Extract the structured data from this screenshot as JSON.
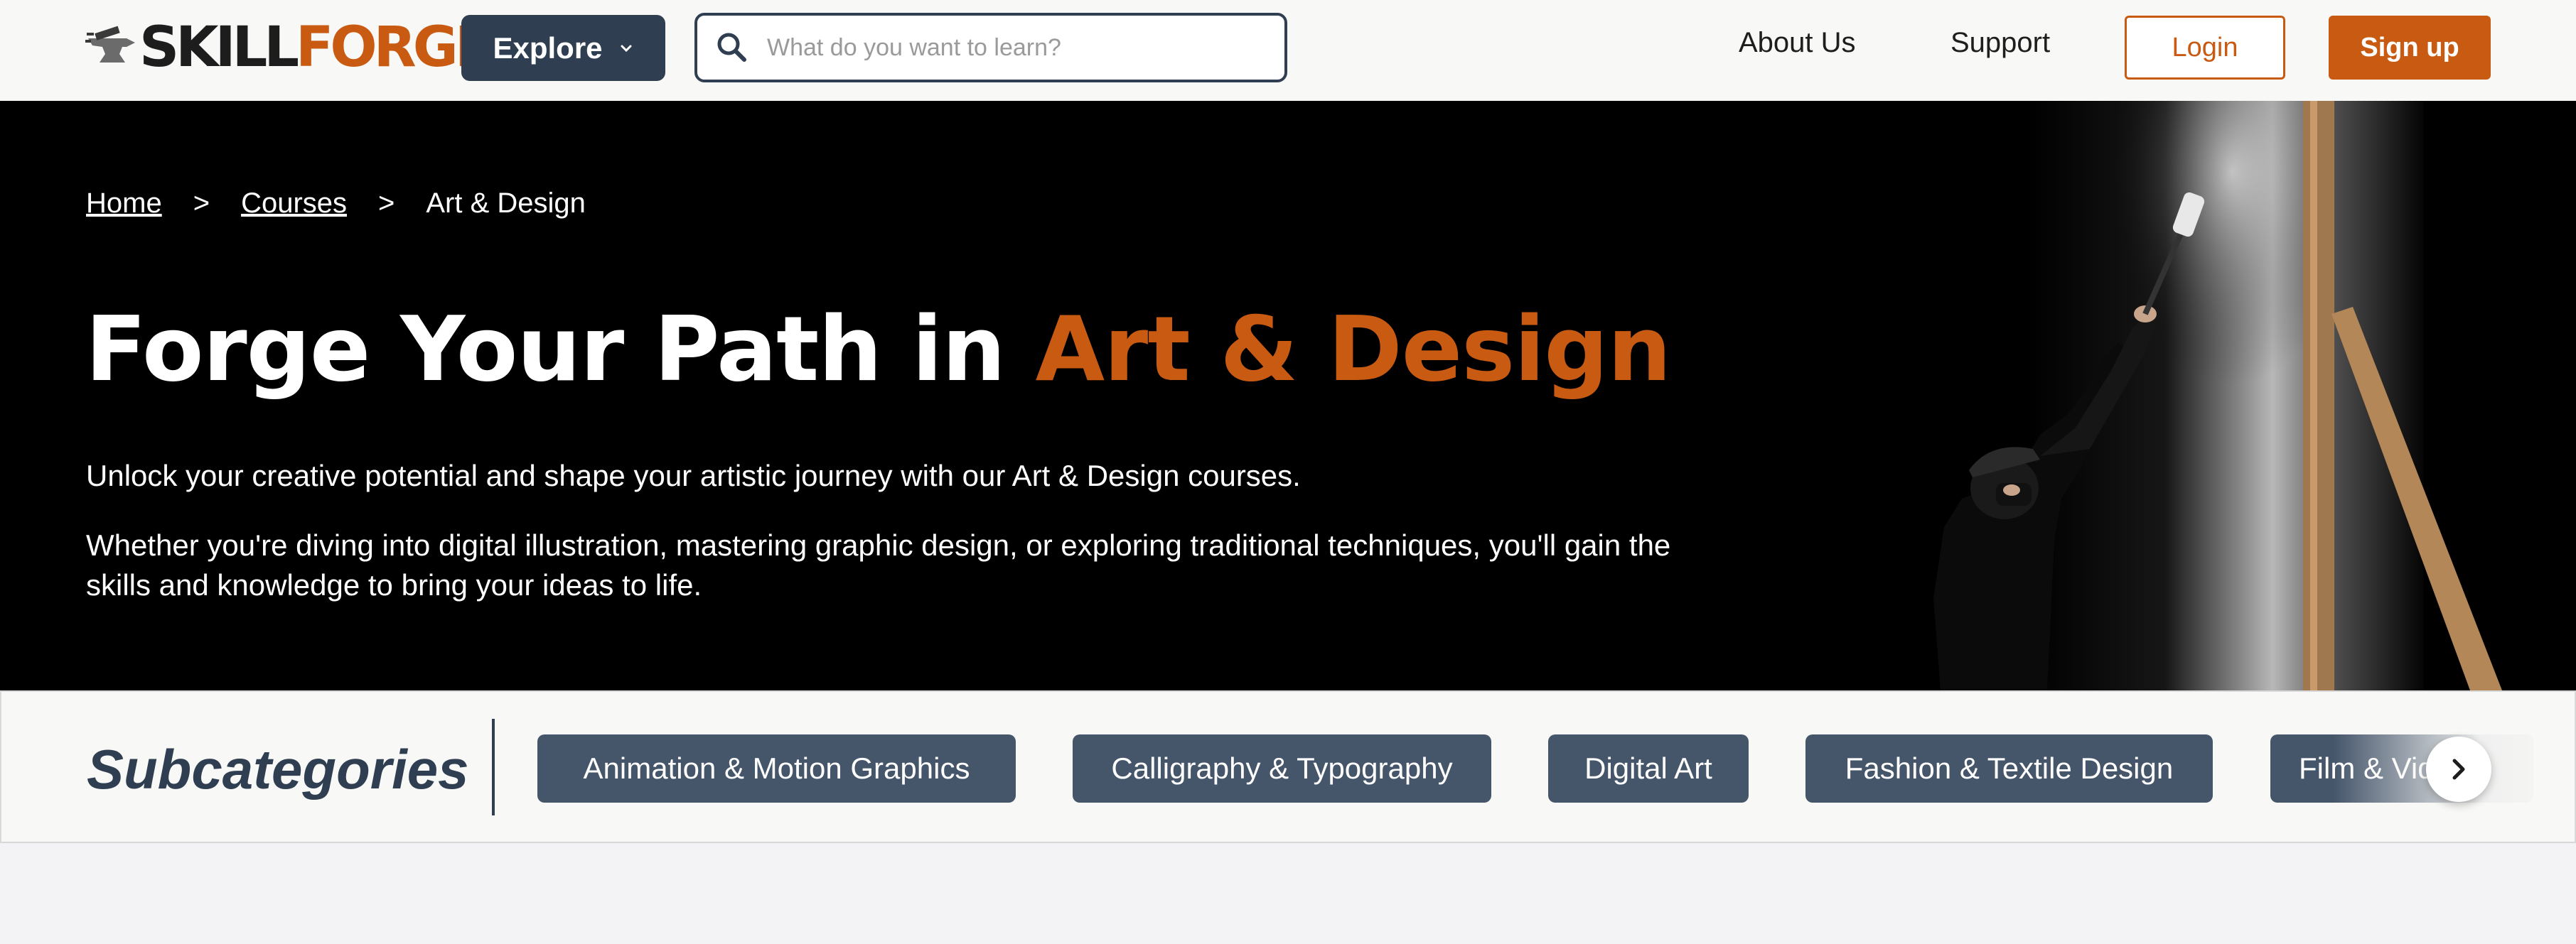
{
  "header": {
    "logo_part1": "SKILL",
    "logo_part2": "FORGE",
    "explore_label": "Explore",
    "search_placeholder": "What do you want to learn?",
    "nav_about": "About Us",
    "nav_support": "Support",
    "login_label": "Login",
    "signup_label": "Sign up"
  },
  "breadcrumb": {
    "home": "Home",
    "courses": "Courses",
    "current": "Art & Design",
    "separator": ">"
  },
  "hero": {
    "title_prefix": "Forge Your Path in ",
    "title_accent": "Art & Design",
    "paragraph1": "Unlock your creative potential and shape your artistic journey with our Art & Design courses.",
    "paragraph2": "Whether you're diving into digital illustration, mastering graphic design, or exploring traditional techniques, you'll gain the skills and knowledge to bring your ideas to life."
  },
  "subcategories": {
    "title": "Subcategories",
    "items": [
      {
        "label": "Animation & Motion Graphics"
      },
      {
        "label": "Calligraphy & Typography"
      },
      {
        "label": "Digital Art"
      },
      {
        "label": "Fashion & Textile Design"
      },
      {
        "label": "Film & Video"
      }
    ],
    "next_icon": "chevron-right-icon"
  },
  "colors": {
    "brand_orange": "#c95a12",
    "navy": "#2f3e51",
    "chip": "#45556a"
  }
}
